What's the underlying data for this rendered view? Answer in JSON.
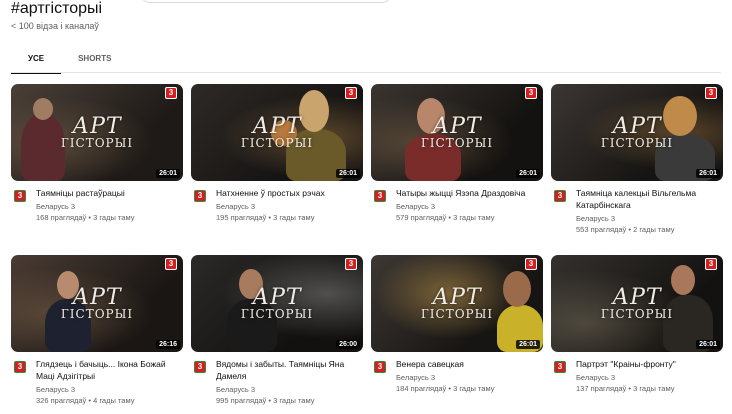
{
  "header": {
    "hashtag": "#артгісторыі",
    "stats": "< 100 відэа і каналаў"
  },
  "tabs": [
    {
      "label": "УСЕ",
      "active": true
    },
    {
      "label": "SHORTS",
      "active": false
    }
  ],
  "brand": {
    "script": "АРТ",
    "sub": "ГІСТОРЫІ",
    "channel_logo": "3"
  },
  "videos": [
    {
      "title": "Таямніцы растаўрацыі",
      "channel": "Беларусь 3",
      "stats": "168 праглядаў • 3 гады таму",
      "duration": "26:01"
    },
    {
      "title": "Натхненне ў простых рэчах",
      "channel": "Беларусь 3",
      "stats": "195 праглядаў • 3 гады таму",
      "duration": "26:01"
    },
    {
      "title": "Чатыры жыцці Язэпа Драздовіча",
      "channel": "Беларусь 3",
      "stats": "579 праглядаў • 3 гады таму",
      "duration": "26:01"
    },
    {
      "title": "Таямніца калекцыі Вільгельма Катарбінскага",
      "channel": "Беларусь 3",
      "stats": "553 праглядаў • 2 гады таму",
      "duration": "26:01"
    },
    {
      "title": "Глядзець і бачыць... Ікона Божай Маці Адзігітрыі",
      "channel": "Беларусь 3",
      "stats": "326 праглядаў • 4 гады таму",
      "duration": "26:16"
    },
    {
      "title": "Вядомы і забыты. Таямніцы Яна Дамеля",
      "channel": "Беларусь 3",
      "stats": "995 праглядаў • 3 гады таму",
      "duration": "26:00"
    },
    {
      "title": "Венера савецкая",
      "channel": "Беларусь 3",
      "stats": "184 праглядаў • 3 гады таму",
      "duration": "26:01"
    },
    {
      "title": "Партрэт \"Краіны-фронту\"",
      "channel": "Беларусь 3",
      "stats": "137 праглядаў • 3 гады таму",
      "duration": "26:01"
    }
  ],
  "colors": {
    "channel_red": "#d21f1f",
    "channel_green": "#2f8a3c",
    "tab_active": "#0f0f0f",
    "meta": "#606060"
  }
}
